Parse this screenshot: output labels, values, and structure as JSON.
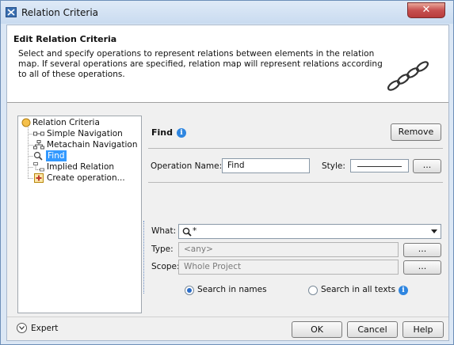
{
  "window": {
    "title": "Relation Criteria",
    "close_glyph": "✕"
  },
  "header": {
    "title": "Edit Relation Criteria",
    "description": "Select and specify operations to represent relations between elements in the relation map. If several operations are specified, relation map will represent relations according to all of these operations."
  },
  "tree": {
    "root": "Relation Criteria",
    "items": [
      {
        "label": "Simple Navigation",
        "icon": "simple-navigation-icon"
      },
      {
        "label": "Metachain Navigation",
        "icon": "metachain-icon"
      },
      {
        "label": "Find",
        "icon": "find-icon",
        "selected": true
      },
      {
        "label": "Implied Relation",
        "icon": "implied-relation-icon"
      },
      {
        "label": "Create operation...",
        "icon": "add-icon"
      }
    ]
  },
  "operation": {
    "title": "Find",
    "remove_label": "Remove",
    "name_label": "Operation Name:",
    "name_value": "Find",
    "style_label": "Style:",
    "ellipsis": "...",
    "what_label": "What:",
    "what_value": "*",
    "type_label": "Type:",
    "type_value": "<any>",
    "scope_label": "Scope:",
    "scope_value": "Whole Project",
    "search_names_label": "Search in names",
    "search_all_label": "Search in all texts",
    "search_mode": "names"
  },
  "footer": {
    "expert_label": "Expert",
    "ok_label": "OK",
    "cancel_label": "Cancel",
    "help_label": "Help"
  },
  "colors": {
    "selection": "#3399ff",
    "info": "#2f86e0",
    "close": "#c75050"
  }
}
